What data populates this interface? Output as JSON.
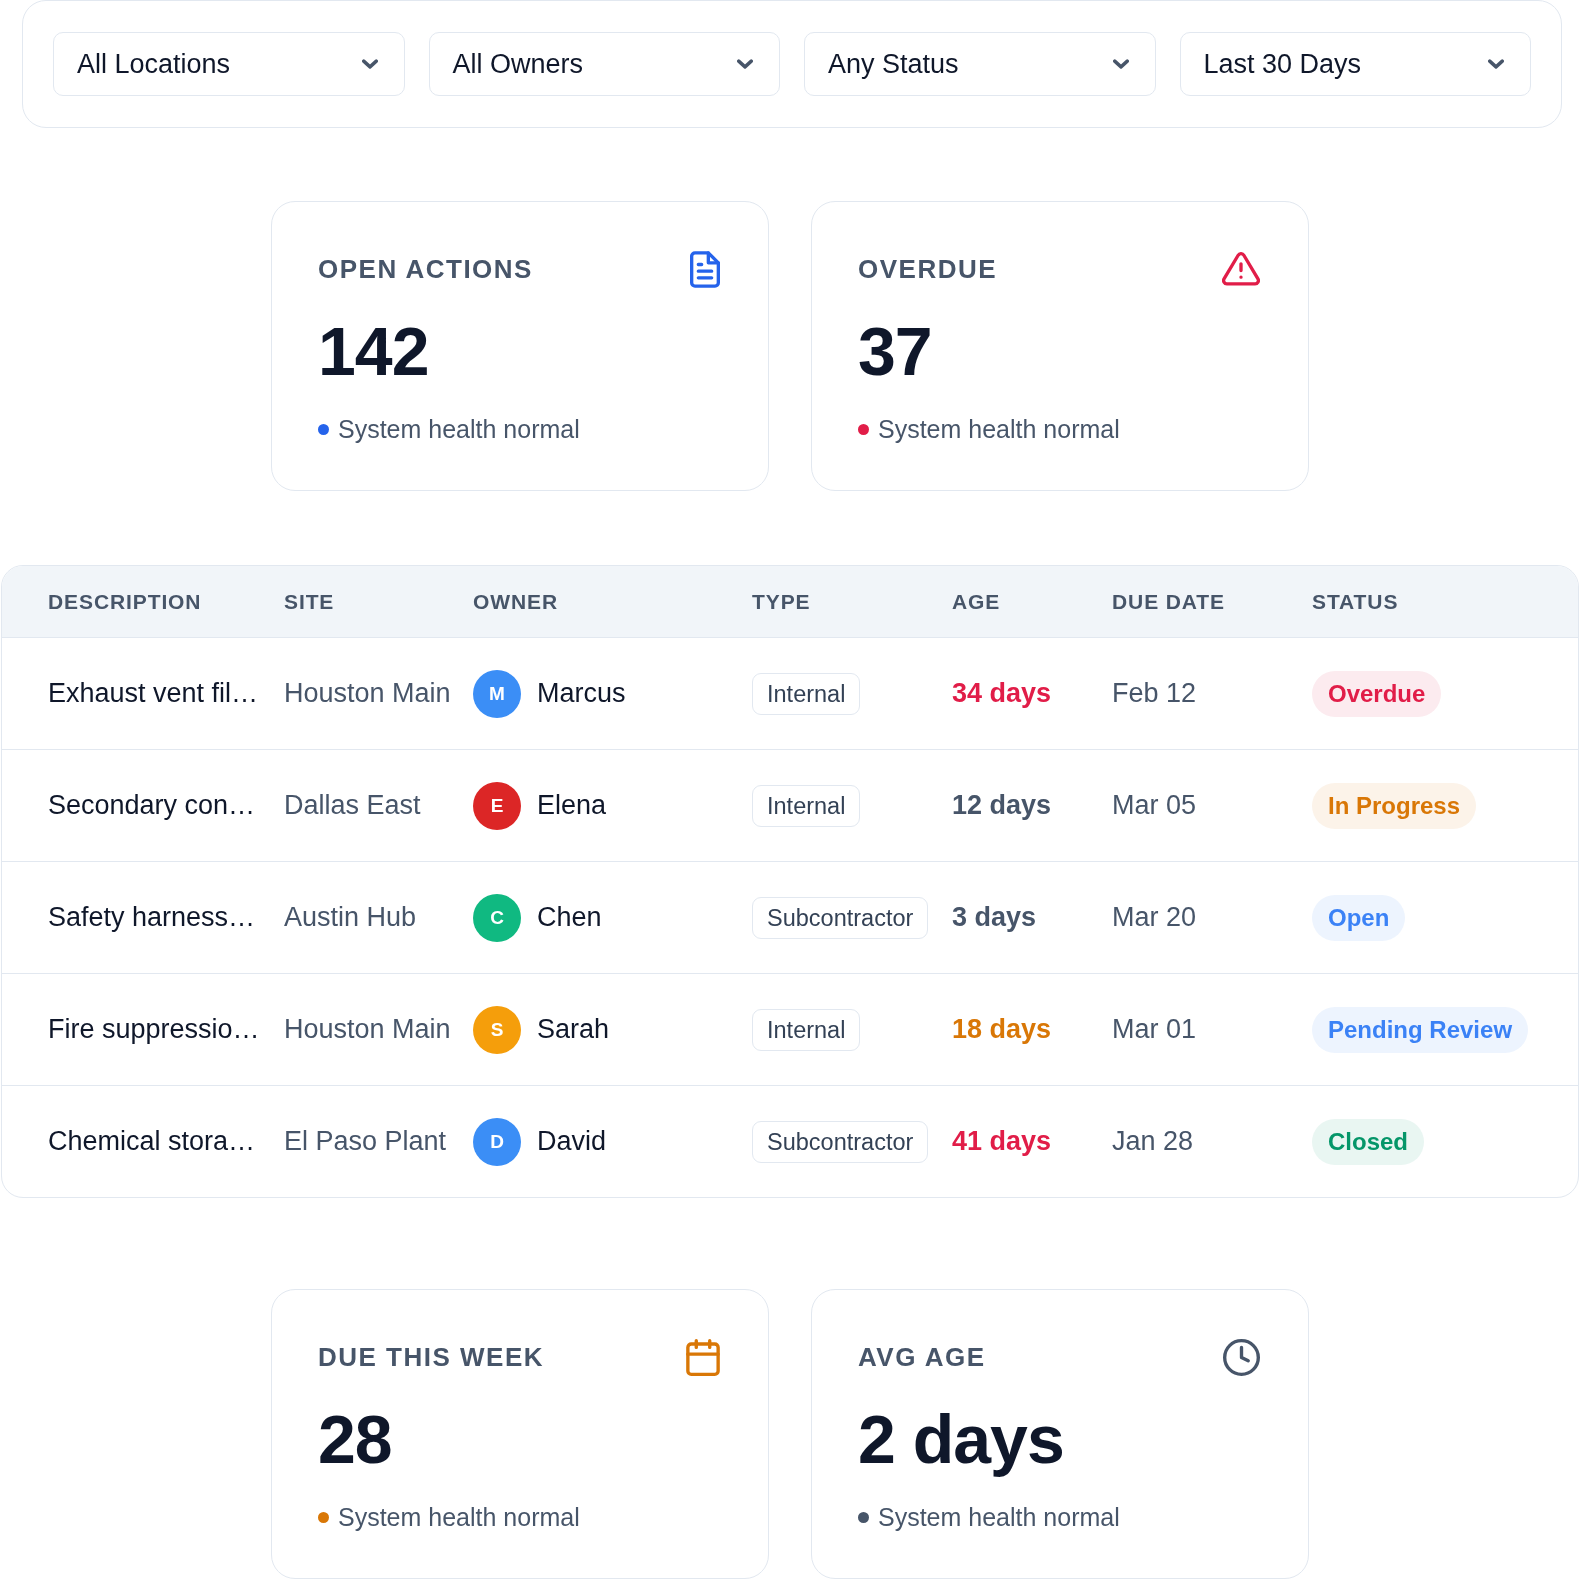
{
  "filters": [
    {
      "label": "All Locations"
    },
    {
      "label": "All Owners"
    },
    {
      "label": "Any Status"
    },
    {
      "label": "Last 30 Days"
    }
  ],
  "top_metrics": [
    {
      "label": "OPEN ACTIONS",
      "value": "142",
      "kind": "document",
      "color": "#2563eb",
      "status": "System health normal"
    },
    {
      "label": "OVERDUE",
      "value": "37",
      "kind": "warning",
      "color": "#e11d48",
      "status": "System health normal"
    }
  ],
  "table": {
    "columns": [
      "DESCRIPTION",
      "SITE",
      "OWNER",
      "TYPE",
      "AGE",
      "DUE DATE",
      "STATUS"
    ],
    "rows": [
      {
        "description": "Exhaust vent fil…",
        "site": "Houston Main",
        "owner": {
          "initial": "M",
          "name": "Marcus",
          "color": "#3b8ef6"
        },
        "type": "Internal",
        "age": {
          "text": "34 days",
          "color": "#e11d48"
        },
        "due_date": "Feb 12",
        "status": {
          "text": "Overdue",
          "color": "#e11d48"
        }
      },
      {
        "description": "Secondary con…",
        "site": "Dallas East",
        "owner": {
          "initial": "E",
          "name": "Elena",
          "color": "#dc2626"
        },
        "type": "Internal",
        "age": {
          "text": "12 days",
          "color": "#475569"
        },
        "due_date": "Mar 05",
        "status": {
          "text": "In Progress",
          "color": "#d97706"
        }
      },
      {
        "description": "Safety harness…",
        "site": "Austin Hub",
        "owner": {
          "initial": "C",
          "name": "Chen",
          "color": "#10b981"
        },
        "type": "Subcontractor",
        "age": {
          "text": "3 days",
          "color": "#475569"
        },
        "due_date": "Mar 20",
        "status": {
          "text": "Open",
          "color": "#3b82f6"
        }
      },
      {
        "description": "Fire suppressio…",
        "site": "Houston Main",
        "owner": {
          "initial": "S",
          "name": "Sarah",
          "color": "#f59e0b"
        },
        "type": "Internal",
        "age": {
          "text": "18 days",
          "color": "#d97706"
        },
        "due_date": "Mar 01",
        "status": {
          "text": "Pending Review",
          "color": "#3b82f6"
        }
      },
      {
        "description": "Chemical stora…",
        "site": "El Paso Plant",
        "owner": {
          "initial": "D",
          "name": "David",
          "color": "#3b8ef6"
        },
        "type": "Subcontractor",
        "age": {
          "text": "41 days",
          "color": "#e11d48"
        },
        "due_date": "Jan 28",
        "status": {
          "text": "Closed",
          "color": "#059669"
        }
      }
    ]
  },
  "bottom_metrics": [
    {
      "label": "DUE THIS WEEK",
      "value": "28",
      "kind": "calendar",
      "color": "#d97706",
      "status": "System health normal"
    },
    {
      "label": "AVG AGE",
      "value": "2 days",
      "kind": "clock",
      "color": "#475569",
      "status": "System health normal"
    }
  ]
}
